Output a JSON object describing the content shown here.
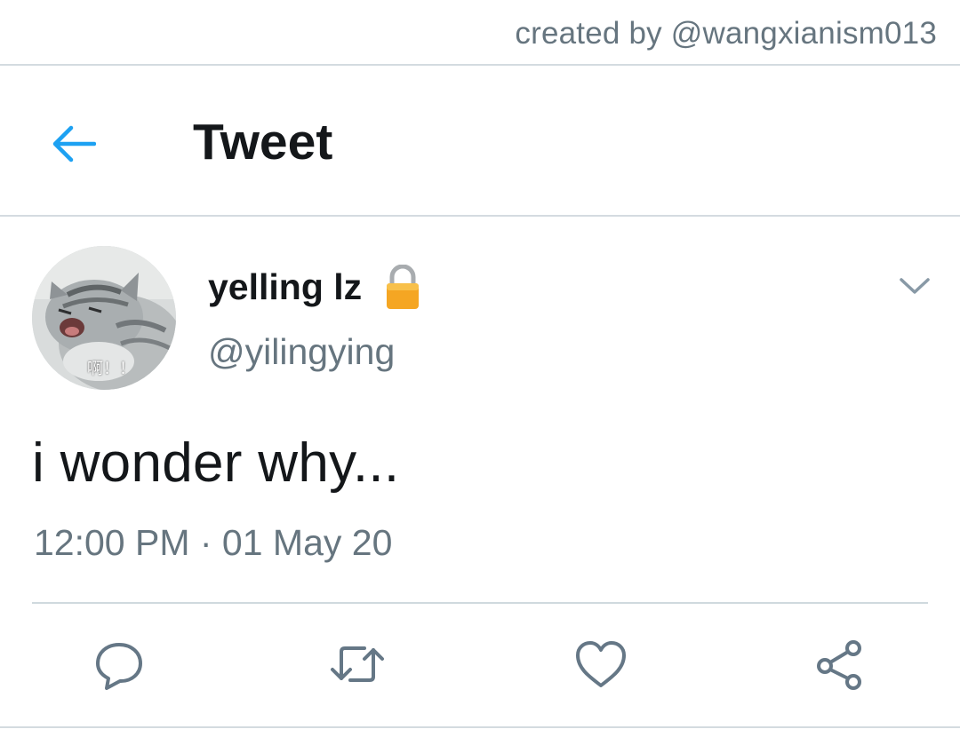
{
  "credit": "created by @wangxianism013",
  "header": {
    "title": "Tweet",
    "back_icon": "back-arrow-icon"
  },
  "tweet": {
    "display_name": "yelling lz",
    "handle": "@yilingying",
    "protected_icon": "lock-icon",
    "menu_icon": "chevron-down-icon",
    "avatar_caption": "啊！！",
    "text": "i wonder why...",
    "timestamp": "12:00 PM · 01 May 20"
  },
  "actions": [
    {
      "name": "reply",
      "icon": "reply-icon"
    },
    {
      "name": "retweet",
      "icon": "retweet-icon"
    },
    {
      "name": "like",
      "icon": "heart-icon"
    },
    {
      "name": "share",
      "icon": "share-icon"
    }
  ],
  "colors": {
    "accent": "#1da1f2",
    "secondary_text": "#66757f",
    "primary_text": "#14171a",
    "divider": "#d4dbe0",
    "lock": "#f5a623"
  }
}
